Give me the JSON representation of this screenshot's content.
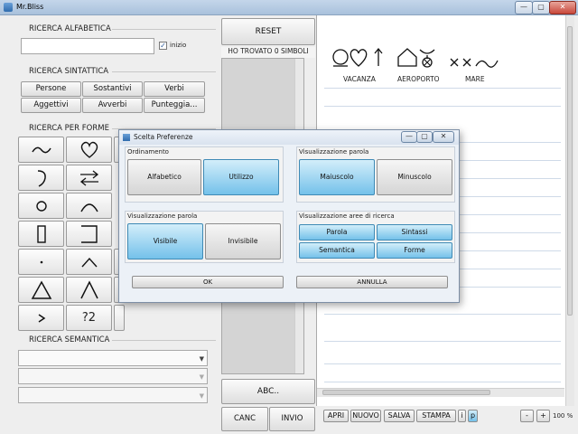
{
  "window": {
    "title": "Mr.Bliss",
    "min": "—",
    "max": "▢",
    "close": "✕"
  },
  "left": {
    "alpha": {
      "label": "RICERCA ALFABETICA",
      "input_value": "",
      "checkbox_label": "inizio",
      "checked": true
    },
    "syntax": {
      "label": "RICERCA SINTATTICA",
      "buttons": [
        "Persone",
        "Sostantivi",
        "Verbi",
        "Aggettivi",
        "Avverbi",
        "Punteggia..."
      ]
    },
    "shapes": {
      "label": "RICERCA PER FORME",
      "qmark_label": "?2"
    },
    "semantic": {
      "label": "RICERCA SEMANTICA"
    }
  },
  "middle": {
    "reset": "RESET",
    "found": "HO TROVATO 0 SIMBOLI",
    "abc": "ABC..",
    "canc": "CANC",
    "invio": "INVIO"
  },
  "right": {
    "symbols": [
      {
        "label": "VACANZA",
        "icon": "vacanza-symbol"
      },
      {
        "label": "AEROPORTO",
        "icon": "aeroporto-symbol"
      },
      {
        "label": "MARE",
        "icon": "mare-symbol"
      }
    ],
    "toolbar": [
      "APRI",
      "NUOVO",
      "SALVA",
      "STAMPA",
      "i",
      "p"
    ],
    "zoom_minus": "-",
    "zoom_plus": "+",
    "zoom_level": "100 %"
  },
  "dialog": {
    "title": "Scelta Preferenze",
    "ordinamento": {
      "label": "Ordinamento",
      "options": [
        "Alfabetico",
        "Utilizzo"
      ],
      "selected": "Utilizzo"
    },
    "vis_parola_case": {
      "label": "Visualizzazione parola",
      "options": [
        "Maiuscolo",
        "Minuscolo"
      ],
      "selected": "Maiuscolo"
    },
    "vis_parola_show": {
      "label": "Visualizzazione parola",
      "options": [
        "Visibile",
        "Invisibile"
      ],
      "selected": "Visibile"
    },
    "vis_aree": {
      "label": "Visualizzazione aree di ricerca",
      "options": [
        "Parola",
        "Sintassi",
        "Semantica",
        "Forme"
      ]
    },
    "ok": "OK",
    "annulla": "ANNULLA"
  },
  "colors": {
    "selected": "#74c1ea",
    "background": "#eeeeee"
  }
}
